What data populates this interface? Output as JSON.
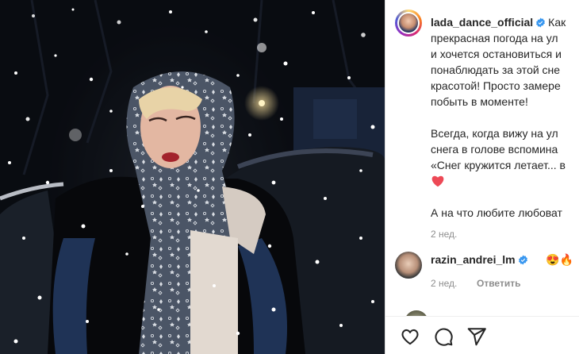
{
  "post": {
    "username": "lada_dance_official",
    "caption_lines": [
      "Как прекрасная погода на улице",
      "и хочется остановиться и",
      "понаблюдать за этой снежной",
      "красотой! Просто замереть и",
      "побыть в моменте!"
    ],
    "caption_text": "Как\nпрекрасная погода на ул\nи хочется остановиться и\nпонаблюдать за этой сне\nкрасотой! Просто замере\nпобыть в моменте!",
    "caption_p2": "Всегда, когда вижу на ул\nснега в голове вспомина\n«Снег кружится летает... в",
    "caption_p3": "А на что любите любоват",
    "time": "2 нед."
  },
  "comment": {
    "username": "razin_andrei_lm",
    "emojis": [
      "😍",
      "🔥"
    ],
    "time": "2 нед.",
    "reply_label": "Ответить"
  },
  "icons": {
    "like": "heart-outline-icon",
    "comment": "comment-bubble-icon",
    "share": "paper-plane-icon"
  },
  "colors": {
    "verified": "#3897f0",
    "heart": "#ed4956",
    "muted": "#8e8e8e"
  }
}
